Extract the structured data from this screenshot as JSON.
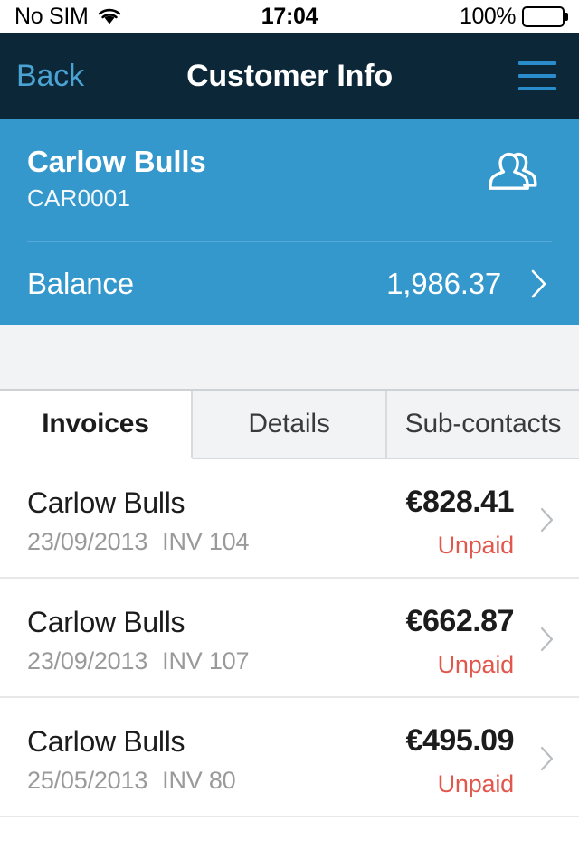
{
  "status_bar": {
    "carrier": "No SIM",
    "wifi_icon": "wifi-icon",
    "time": "17:04",
    "battery_percent": "100%",
    "battery_icon": "battery-full-icon"
  },
  "nav_bar": {
    "back_label": "Back",
    "title": "Customer Info",
    "menu_icon": "hamburger-menu-icon",
    "background_color": "#0c2738",
    "accent_color": "#4ba3d3"
  },
  "customer": {
    "name": "Carlow Bulls",
    "code": "CAR0001",
    "contacts_icon": "people-icon",
    "balance_label": "Balance",
    "balance_value": "1,986.37",
    "chevron_icon": "chevron-right-icon",
    "background_color": "#3498cd"
  },
  "tabs": [
    {
      "label": "Invoices",
      "active": true
    },
    {
      "label": "Details",
      "active": false
    },
    {
      "label": "Sub-contacts",
      "active": false
    }
  ],
  "invoices": [
    {
      "title": "Carlow Bulls",
      "date": "23/09/2013",
      "number": "INV 104",
      "amount": "€828.41",
      "status": "Unpaid",
      "chevron_icon": "chevron-right-icon"
    },
    {
      "title": "Carlow Bulls",
      "date": "23/09/2013",
      "number": "INV 107",
      "amount": "€662.87",
      "status": "Unpaid",
      "chevron_icon": "chevron-right-icon"
    },
    {
      "title": "Carlow Bulls",
      "date": "25/05/2013",
      "number": "INV 80",
      "amount": "€495.09",
      "status": "Unpaid",
      "chevron_icon": "chevron-right-icon"
    }
  ],
  "colors": {
    "unpaid_status": "#e2574c",
    "panel_blue": "#3498cd",
    "nav_navy": "#0c2738"
  }
}
